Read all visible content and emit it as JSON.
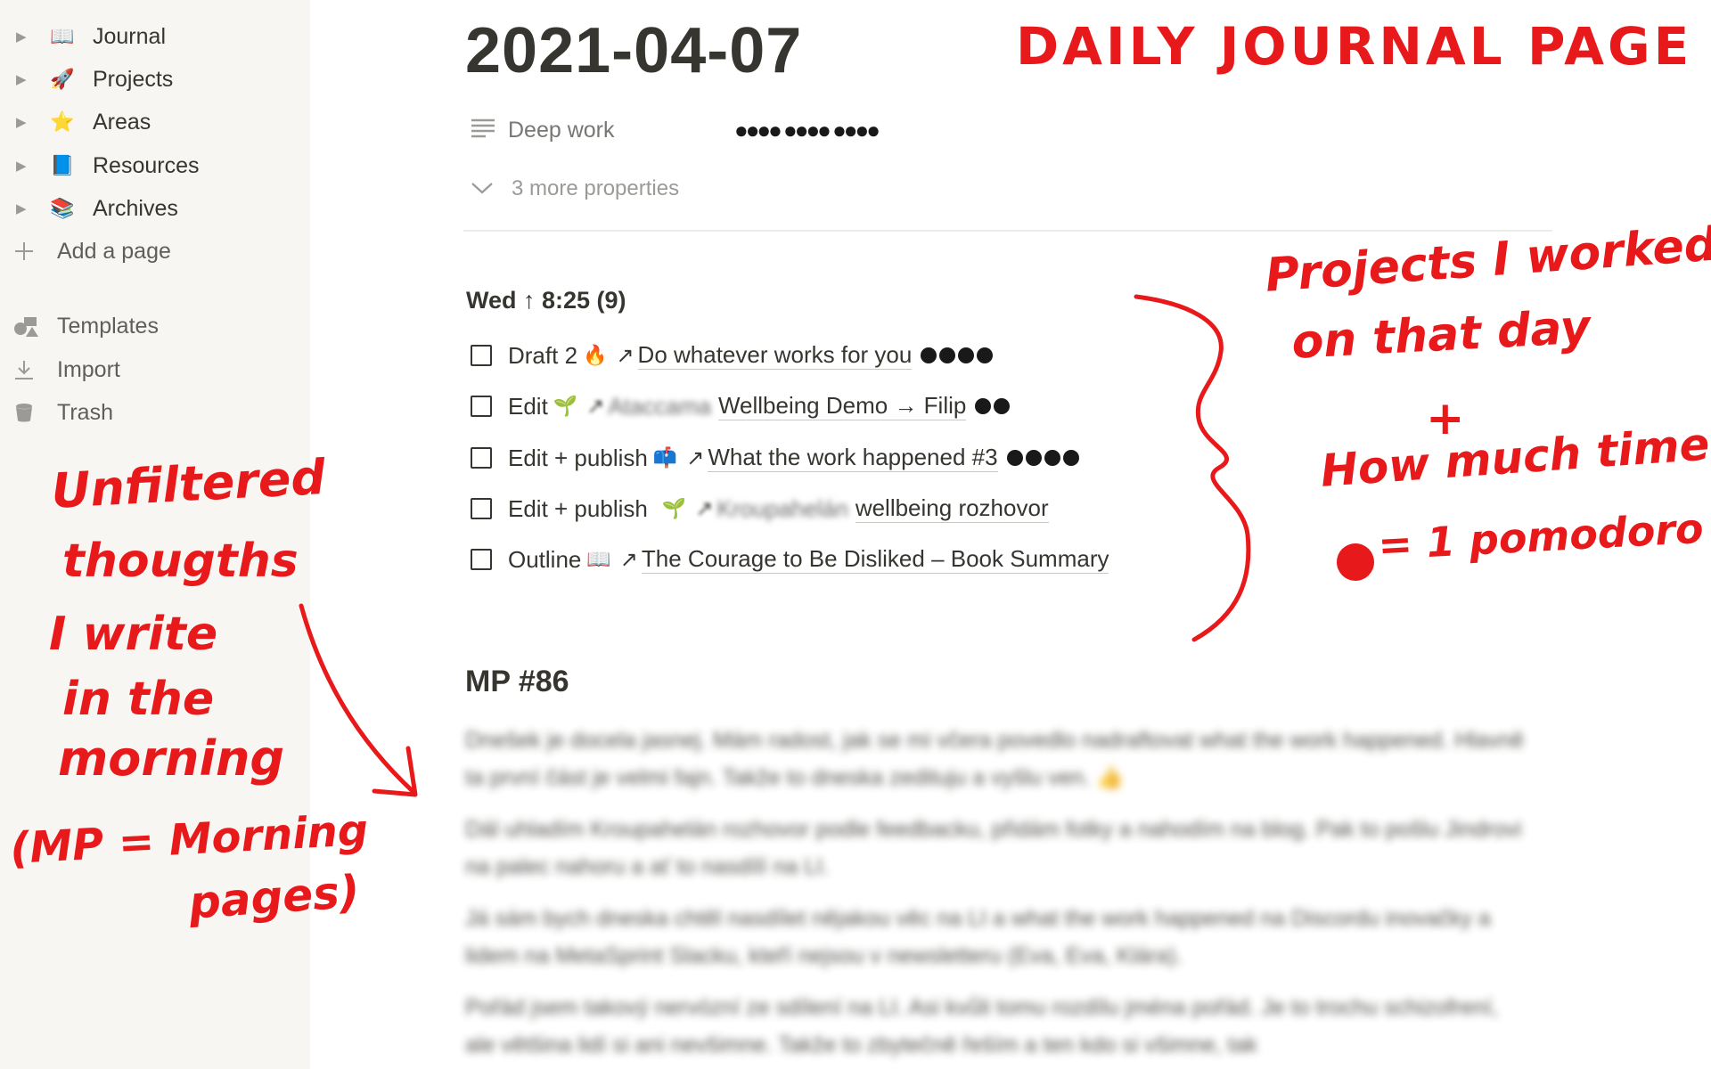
{
  "sidebar": {
    "items": [
      {
        "label": "Journal",
        "icon": "📖"
      },
      {
        "label": "Projects",
        "icon": "🚀"
      },
      {
        "label": "Areas",
        "icon": "⭐"
      },
      {
        "label": "Resources",
        "icon": "📘"
      },
      {
        "label": "Archives",
        "icon": "📚"
      }
    ],
    "add_page": "Add a page",
    "templates": "Templates",
    "import": "Import",
    "trash": "Trash"
  },
  "page": {
    "title": "2021-04-07",
    "property_name": "Deep work",
    "property_value": "●●●● ●●●● ●●●●",
    "more_properties": "3 more properties"
  },
  "day_section": {
    "heading": "Wed ↑ 8:25 (9)",
    "todos": [
      {
        "action": "Draft 2",
        "emoji": "🔥",
        "blurred": "",
        "link": "Do whatever works for you",
        "dots": 4
      },
      {
        "action": "Edit",
        "emoji": "🌱",
        "blurred": "Ataccama",
        "link": "Wellbeing Demo → Filip",
        "dots": 2
      },
      {
        "action": "Edit + publish",
        "emoji": "📫",
        "blurred": "",
        "link": "What the work happened #3",
        "dots": 4
      },
      {
        "action": "Edit + publish",
        "emoji": "🌱",
        "blurred": "Kroupahelán",
        "link": "wellbeing rozhovor",
        "dots": 0
      },
      {
        "action": "Outline",
        "emoji": "📖",
        "blurred": "",
        "link": "The Courage to Be Disliked – Book Summary",
        "dots": 0
      }
    ]
  },
  "mp_section": {
    "heading": "MP #86",
    "paragraphs": [
      "Dnešek je docela jasnej. Mám radost, jak se mi včera povedlo nadraftovat what the work happened. Hlavně ta první část je velmi fajn. Takže to dneska zedituju a vyšlu ven. 👍",
      "Dál uhladím Kroupahelán rozhovor podle feedbacku, přidám fotky a nahodím na blog. Pak to pošlu Jindrovi na palec nahoru a ať to nasdílí na LI.",
      "Já sám bych dneska chtěl nasdílet nějakou věc na LI a what the work happened na Discordu inovačky a lidem na MetaSprint Slacku, kteří nejsou v newsletteru (Eva, Eva, Klára).",
      "Pořád jsem takový nervózní ze sdílení na LI. Asi kvůli tomu rozdílu jména pořád. Je to trochu schizofrení, ale většina lidí si ani nevšimne. Takže to zbytečně řeším a ten kdo si všimne, tak"
    ]
  },
  "annotations": {
    "title_note": "DAILY JOURNAL PAGE",
    "projects_note": [
      "Projects I worked",
      "on that day",
      "+",
      "How much time",
      "= 1 pomodoro"
    ],
    "mp_note": [
      "Unfiltered",
      "thougths",
      "I write",
      "in the",
      "morning",
      "(MP = Morning",
      "pages)"
    ]
  },
  "colors": {
    "annotation": "#e8191b",
    "sidebar_bg": "#f7f6f3",
    "text": "#37352f",
    "muted": "#9b9a97"
  }
}
